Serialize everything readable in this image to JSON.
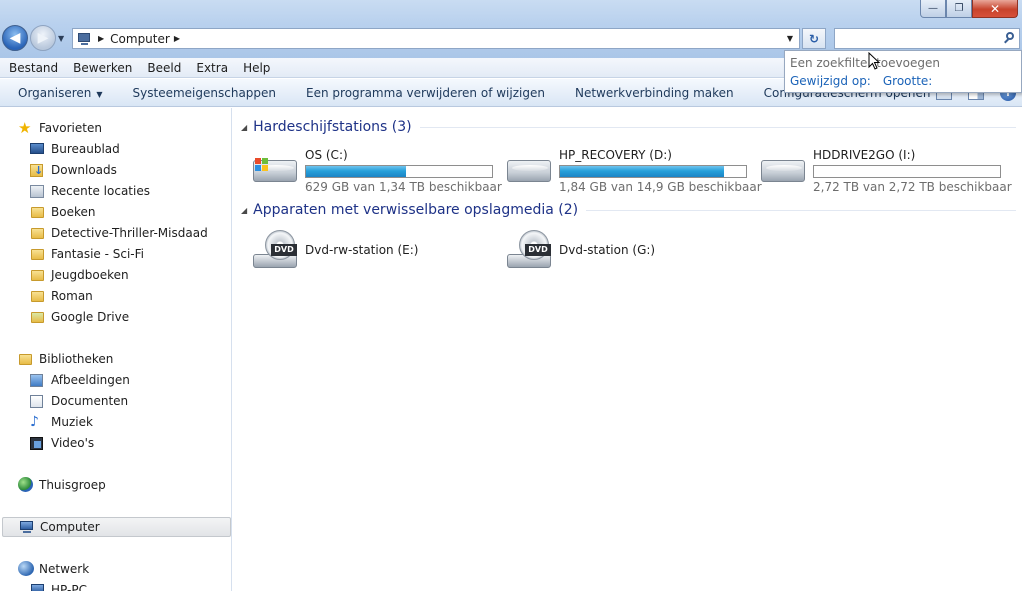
{
  "window": {
    "minimize": "—",
    "maximize": "❐",
    "close": "✕"
  },
  "address": {
    "crumb": "Computer",
    "sep": "▶",
    "dropdown": "▼",
    "refresh": "↻"
  },
  "search": {
    "value": "",
    "placeholder": ""
  },
  "menu": [
    "Bestand",
    "Bewerken",
    "Beeld",
    "Extra",
    "Help"
  ],
  "commands": {
    "organize": "Organiseren",
    "items": [
      "Systeemeigenschappen",
      "Een programma verwijderen of wijzigen",
      "Netwerkverbinding maken",
      "Configuratiescherm openen"
    ]
  },
  "search_dropdown": {
    "hint": "Een zoekfilter toevoegen",
    "filters": [
      "Gewijzigd op:",
      "Grootte:"
    ]
  },
  "nav": {
    "favorites_label": "Favorieten",
    "favorites": [
      "Bureaublad",
      "Downloads",
      "Recente locaties",
      "Boeken",
      "Detective-Thriller-Misdaad",
      "Fantasie - Sci-Fi",
      "Jeugdboeken",
      "Roman",
      "Google Drive"
    ],
    "libraries_label": "Bibliotheken",
    "libraries": [
      "Afbeeldingen",
      "Documenten",
      "Muziek",
      "Video's"
    ],
    "homegroup": "Thuisgroep",
    "computer": "Computer",
    "network": "Netwerk",
    "network_child": "HP-PC"
  },
  "groups": {
    "hdd": {
      "title": "Hardeschijfstations (3)"
    },
    "removable": {
      "title": "Apparaten met verwisselbare opslagmedia (2)"
    }
  },
  "drives": [
    {
      "name": "OS (C:)",
      "free": "629 GB van 1,34 TB beschikbaar",
      "used_fraction": 0.54
    },
    {
      "name": "HP_RECOVERY (D:)",
      "free": "1,84 GB van 14,9 GB beschikbaar",
      "used_fraction": 0.88
    },
    {
      "name": "HDDRIVE2GO (I:)",
      "free": "2,72 TB van 2,72 TB beschikbaar",
      "used_fraction": 0.0
    }
  ],
  "removable": [
    {
      "name": "Dvd-rw-station (E:)",
      "badge": "DVD"
    },
    {
      "name": "Dvd-station (G:)",
      "badge": "DVD"
    }
  ],
  "colors": {
    "bar_fill": "#26a0da",
    "group_header": "#1e3287",
    "link": "#1b63b8"
  }
}
